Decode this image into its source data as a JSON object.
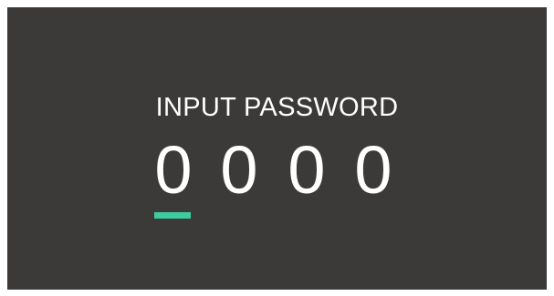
{
  "prompt": {
    "title": "INPUT PASSWORD"
  },
  "password": {
    "digits": [
      "0",
      "0",
      "0",
      "0"
    ],
    "active_index": 0
  },
  "colors": {
    "background": "#3b3a39",
    "text": "#ffffff",
    "cursor": "#3dcca0"
  }
}
